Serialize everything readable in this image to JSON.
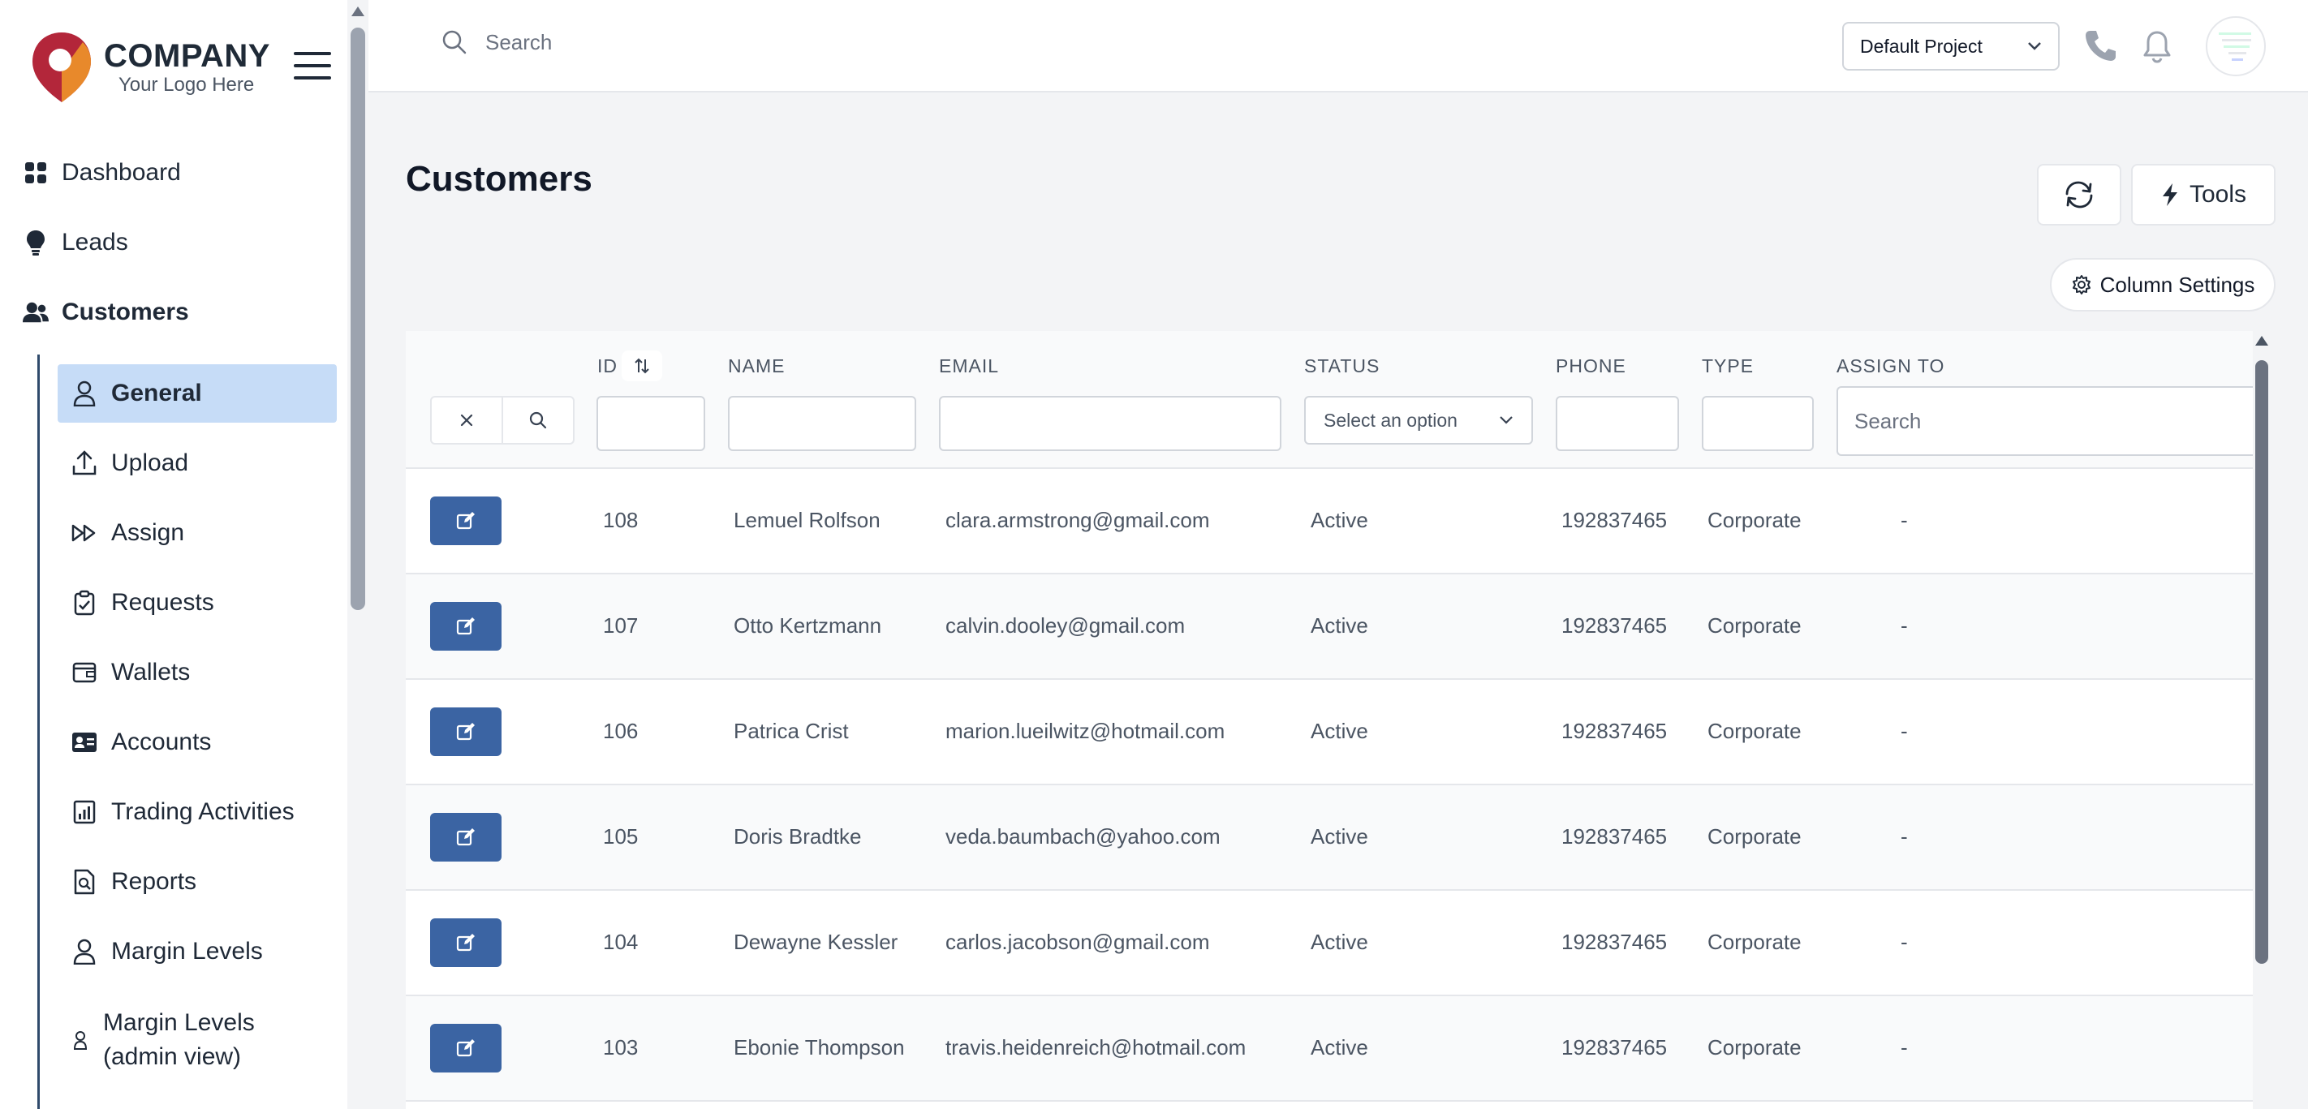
{
  "brand": {
    "name": "COMPANY",
    "tagline": "Your Logo Here"
  },
  "topbar": {
    "search_placeholder": "Search",
    "project": "Default Project"
  },
  "sidebar": {
    "top_items": [
      {
        "label": "Dashboard",
        "icon": "dashboard-grid-icon"
      },
      {
        "label": "Leads",
        "icon": "lightbulb-icon"
      },
      {
        "label": "Customers",
        "icon": "users-icon",
        "active": true
      }
    ],
    "sub_items": [
      {
        "label": "General",
        "icon": "user-icon",
        "active": true
      },
      {
        "label": "Upload",
        "icon": "upload-icon"
      },
      {
        "label": "Assign",
        "icon": "forward-icon"
      },
      {
        "label": "Requests",
        "icon": "clipboard-check-icon"
      },
      {
        "label": "Wallets",
        "icon": "wallet-icon"
      },
      {
        "label": "Accounts",
        "icon": "id-card-icon"
      },
      {
        "label": "Trading Activities",
        "icon": "bar-chart-icon"
      },
      {
        "label": "Reports",
        "icon": "report-icon"
      },
      {
        "label": "Margin Levels",
        "icon": "user-icon"
      },
      {
        "label": "Margin Levels (admin view)",
        "icon": "user-small-icon"
      }
    ]
  },
  "main": {
    "title": "Customers",
    "tools_label": "Tools",
    "column_settings_label": "Column Settings"
  },
  "table": {
    "columns": [
      "ID",
      "NAME",
      "EMAIL",
      "STATUS",
      "PHONE",
      "TYPE",
      "ASSIGN TO"
    ],
    "status_placeholder": "Select an option",
    "assign_placeholder": "Search",
    "rows": [
      {
        "id": "108",
        "name": "Lemuel Rolfson",
        "email": "clara.armstrong@gmail.com",
        "status": "Active",
        "phone": "192837465",
        "type": "Corporate",
        "assign": "-"
      },
      {
        "id": "107",
        "name": "Otto Kertzmann",
        "email": "calvin.dooley@gmail.com",
        "status": "Active",
        "phone": "192837465",
        "type": "Corporate",
        "assign": "-"
      },
      {
        "id": "106",
        "name": "Patrica Crist",
        "email": "marion.lueilwitz@hotmail.com",
        "status": "Active",
        "phone": "192837465",
        "type": "Corporate",
        "assign": "-"
      },
      {
        "id": "105",
        "name": "Doris Bradtke",
        "email": "veda.baumbach@yahoo.com",
        "status": "Active",
        "phone": "192837465",
        "type": "Corporate",
        "assign": "-"
      },
      {
        "id": "104",
        "name": "Dewayne Kessler",
        "email": "carlos.jacobson@gmail.com",
        "status": "Active",
        "phone": "192837465",
        "type": "Corporate",
        "assign": "-"
      },
      {
        "id": "103",
        "name": "Ebonie Thompson",
        "email": "travis.heidenreich@hotmail.com",
        "status": "Active",
        "phone": "192837465",
        "type": "Corporate",
        "assign": "-"
      }
    ]
  },
  "colors": {
    "accent": "#3b64a3",
    "active_bg": "#c6dcf7",
    "brand_red": "#b3263a",
    "brand_orange": "#e8892b"
  }
}
